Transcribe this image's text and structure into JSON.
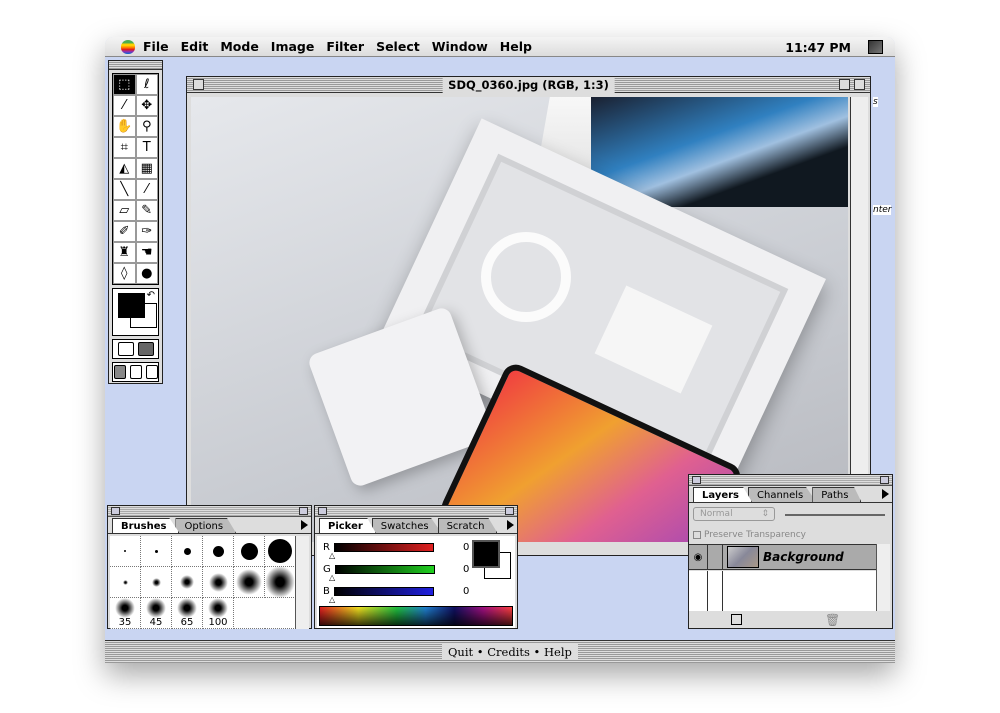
{
  "menubar": {
    "items": [
      "File",
      "Edit",
      "Mode",
      "Image",
      "Filter",
      "Select",
      "Window",
      "Help"
    ],
    "clock": "11:47 PM"
  },
  "document": {
    "title": "SDQ_0360.jpg (RGB, 1:3)"
  },
  "brushes_palette": {
    "tabs": [
      "Brushes",
      "Options"
    ],
    "labels": [
      "35",
      "45",
      "65",
      "100"
    ]
  },
  "picker_palette": {
    "tabs": [
      "Picker",
      "Swatches",
      "Scratch"
    ],
    "channels": [
      {
        "label": "R",
        "value": "0",
        "color": "#e02020"
      },
      {
        "label": "G",
        "value": "0",
        "color": "#20d020"
      },
      {
        "label": "B",
        "value": "0",
        "color": "#2020e0"
      }
    ]
  },
  "layers_palette": {
    "tabs": [
      "Layers",
      "Channels",
      "Paths"
    ],
    "blend_mode": "Normal",
    "preserve_transparency": "Preserve Transparency",
    "layer_name": "Background"
  },
  "bottom_bar": {
    "links": "Quit • Credits • Help"
  },
  "background_fragments": [
    "s",
    "nter"
  ]
}
